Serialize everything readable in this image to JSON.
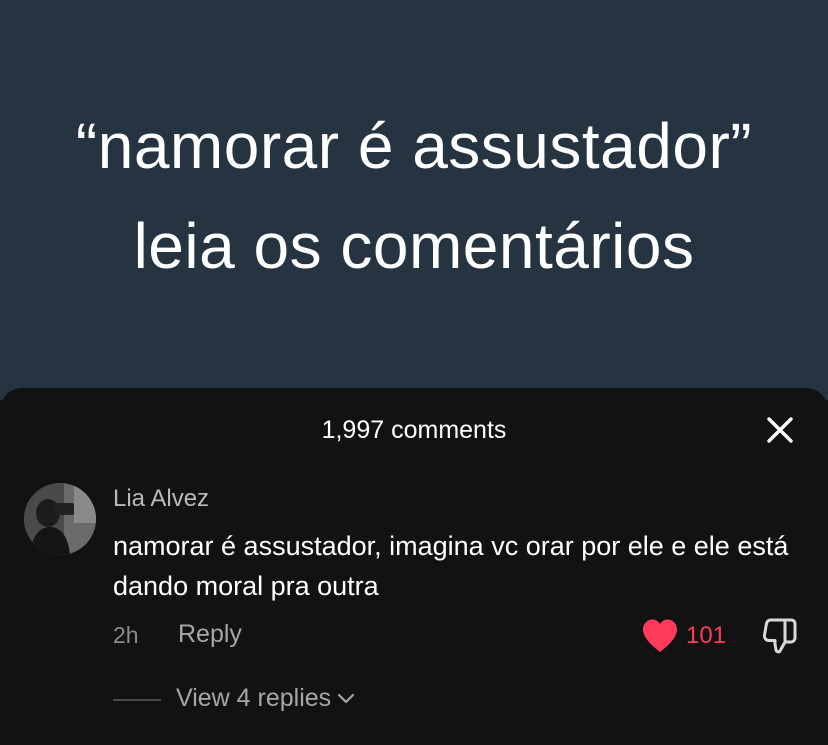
{
  "video": {
    "caption_line1": "“namorar é assustador”",
    "caption_line2": "leia os comentários",
    "bg_color": "#263340"
  },
  "comments_sheet": {
    "title": "1,997 comments",
    "close_icon": "close-icon"
  },
  "comment": {
    "username": "Lia Alvez",
    "text": "namorar é assustador, imagina vc orar por ele e ele está dando moral pra outra",
    "time": "2h",
    "reply_label": "Reply",
    "like_count": "101",
    "like_color": "#ff3b5c",
    "view_replies_label": "View 4 replies",
    "icons": [
      "heart-icon",
      "dislike-icon",
      "chevron-down-icon"
    ]
  }
}
